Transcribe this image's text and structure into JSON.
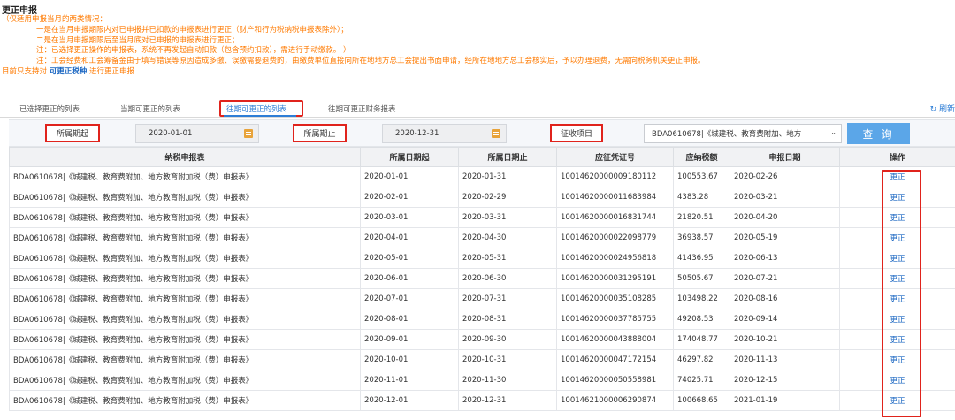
{
  "page_title": "更正申报",
  "notes": [
    "（仅适用申报当月的两类情况：",
    "一是在当月申报期限内对已申报并已扣款的申报表进行更正（财产和行为税纳税申报表除外）；",
    "二是在当月申报期限后至当月底对已申报的申报表进行更正；",
    "注：已选择更正操作的申报表，系统不再发起自动扣款（包含预约扣款），需进行手动缴款。 ）",
    "注：工会经费和工会筹备金由于填写错误等原因造成多缴、误缴需要退费的，由缴费单位直接向所在地地方总工会提出书面申请，经所在地地方总工会核实后，予以办理退费，无需向税务机关更正申报。"
  ],
  "support": {
    "prefix": "目前只支持对",
    "highlight": "可更正税种",
    "suffix": "进行更正申报"
  },
  "tabs": [
    {
      "label": "已选择更正的列表"
    },
    {
      "label": "当期可更正的列表"
    },
    {
      "label": "往期可更正的列表",
      "active": true
    },
    {
      "label": "往期可更正财务报表"
    }
  ],
  "refresh": {
    "icon": "refresh-icon",
    "label": "刷新"
  },
  "filter": {
    "start_label": "所属期起",
    "start_value": "2020-01-01",
    "end_label": "所属期止",
    "end_value": "2020-12-31",
    "item_label": "征收项目",
    "item_value": "BDA0610678|《城建税、教育费附加、地方",
    "query_label": "查 询"
  },
  "table": {
    "headers": [
      "纳税申报表",
      "所属日期起",
      "所属日期止",
      "应征凭证号",
      "应纳税额",
      "申报日期",
      "操作"
    ],
    "rows": [
      {
        "form": "BDA0610678|《城建税、教育费附加、地方教育附加税（费）申报表》",
        "start": "2020-01-01",
        "end": "2020-01-31",
        "voucher": "10014620000009180112",
        "amount": "100553.67",
        "date": "2020-02-26",
        "action": "更正"
      },
      {
        "form": "BDA0610678|《城建税、教育费附加、地方教育附加税（费）申报表》",
        "start": "2020-02-01",
        "end": "2020-02-29",
        "voucher": "10014620000011683984",
        "amount": "4383.28",
        "date": "2020-03-21",
        "action": "更正"
      },
      {
        "form": "BDA0610678|《城建税、教育费附加、地方教育附加税（费）申报表》",
        "start": "2020-03-01",
        "end": "2020-03-31",
        "voucher": "10014620000016831744",
        "amount": "21820.51",
        "date": "2020-04-20",
        "action": "更正"
      },
      {
        "form": "BDA0610678|《城建税、教育费附加、地方教育附加税（费）申报表》",
        "start": "2020-04-01",
        "end": "2020-04-30",
        "voucher": "10014620000022098779",
        "amount": "36938.57",
        "date": "2020-05-19",
        "action": "更正"
      },
      {
        "form": "BDA0610678|《城建税、教育费附加、地方教育附加税（费）申报表》",
        "start": "2020-05-01",
        "end": "2020-05-31",
        "voucher": "10014620000024956818",
        "amount": "41436.95",
        "date": "2020-06-13",
        "action": "更正"
      },
      {
        "form": "BDA0610678|《城建税、教育费附加、地方教育附加税（费）申报表》",
        "start": "2020-06-01",
        "end": "2020-06-30",
        "voucher": "10014620000031295191",
        "amount": "50505.67",
        "date": "2020-07-21",
        "action": "更正"
      },
      {
        "form": "BDA0610678|《城建税、教育费附加、地方教育附加税（费）申报表》",
        "start": "2020-07-01",
        "end": "2020-07-31",
        "voucher": "10014620000035108285",
        "amount": "103498.22",
        "date": "2020-08-16",
        "action": "更正"
      },
      {
        "form": "BDA0610678|《城建税、教育费附加、地方教育附加税（费）申报表》",
        "start": "2020-08-01",
        "end": "2020-08-31",
        "voucher": "10014620000037785755",
        "amount": "49208.53",
        "date": "2020-09-14",
        "action": "更正"
      },
      {
        "form": "BDA0610678|《城建税、教育费附加、地方教育附加税（费）申报表》",
        "start": "2020-09-01",
        "end": "2020-09-30",
        "voucher": "10014620000043888004",
        "amount": "174048.77",
        "date": "2020-10-21",
        "action": "更正"
      },
      {
        "form": "BDA0610678|《城建税、教育费附加、地方教育附加税（费）申报表》",
        "start": "2020-10-01",
        "end": "2020-10-31",
        "voucher": "10014620000047172154",
        "amount": "46297.82",
        "date": "2020-11-13",
        "action": "更正"
      },
      {
        "form": "BDA0610678|《城建税、教育费附加、地方教育附加税（费）申报表》",
        "start": "2020-11-01",
        "end": "2020-11-30",
        "voucher": "10014620000050558981",
        "amount": "74025.71",
        "date": "2020-12-15",
        "action": "更正"
      },
      {
        "form": "BDA0610678|《城建税、教育费附加、地方教育附加税（费）申报表》",
        "start": "2020-12-01",
        "end": "2020-12-31",
        "voucher": "10014621000006290874",
        "amount": "100668.65",
        "date": "2021-01-19",
        "action": "更正"
      }
    ]
  },
  "colors": {
    "accent": "#2e7ed6",
    "notice": "#ff7a00",
    "highlight_box": "#e0231c",
    "query_button": "#5ba6e8"
  }
}
